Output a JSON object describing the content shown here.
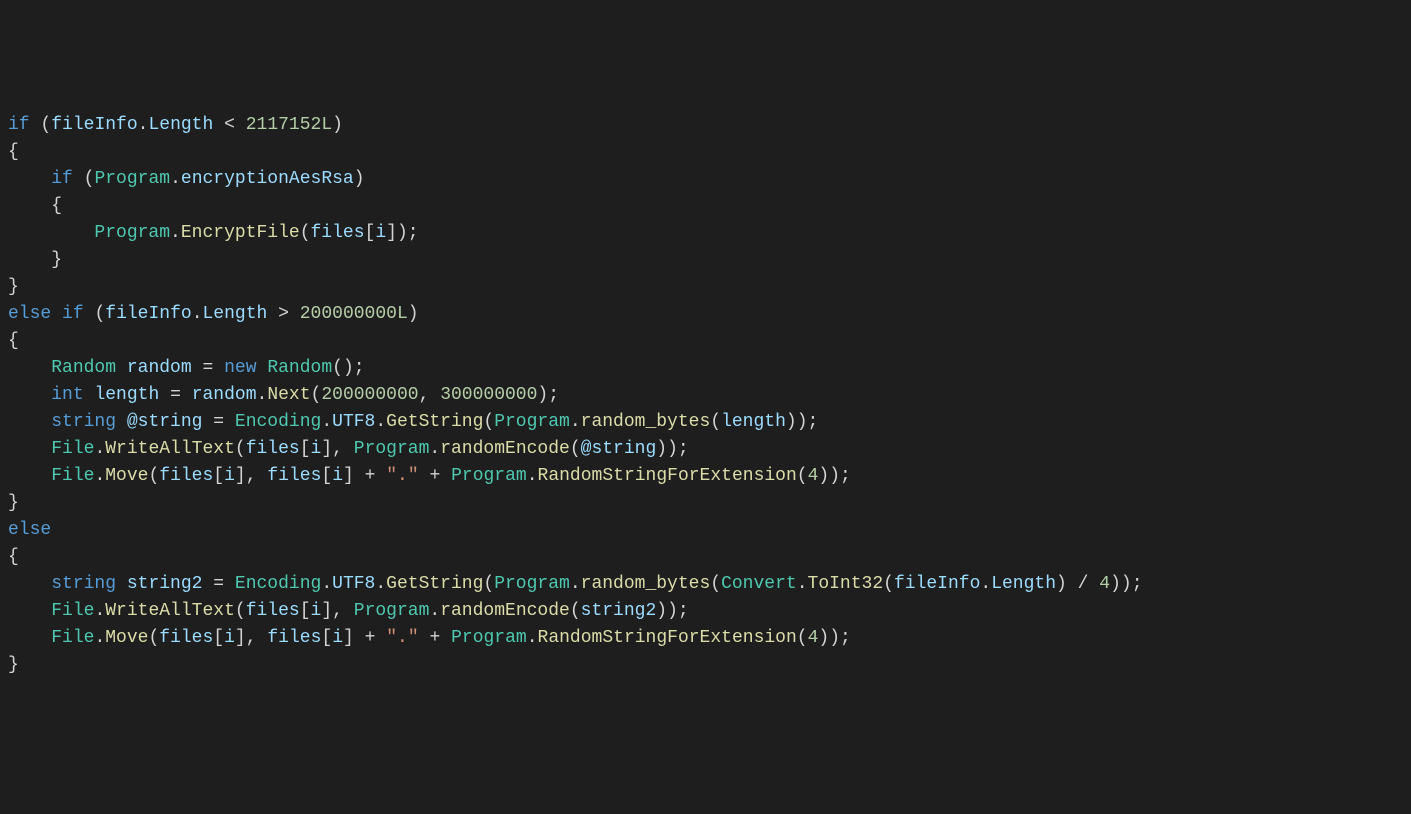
{
  "code": {
    "kw_if": "if",
    "kw_else": "else",
    "kw_new": "new",
    "type_int": "int",
    "type_string": "string",
    "cls_Program": "Program",
    "cls_Random": "Random",
    "cls_Encoding": "Encoding",
    "cls_File": "File",
    "cls_Convert": "Convert",
    "var_fileInfo": "fileInfo",
    "var_random": "random",
    "var_length": "length",
    "var_atstring": "@string",
    "var_string2": "string2",
    "var_files": "files",
    "var_i": "i",
    "prop_Length": "Length",
    "prop_encryptionAesRsa": "encryptionAesRsa",
    "prop_UTF8": "UTF8",
    "method_EncryptFile": "EncryptFile",
    "method_Next": "Next",
    "method_GetString": "GetString",
    "method_random_bytes": "random_bytes",
    "method_WriteAllText": "WriteAllText",
    "method_randomEncode": "randomEncode",
    "method_Move": "Move",
    "method_RandomStringForExtension": "RandomStringForExtension",
    "method_ToInt32": "ToInt32",
    "num_2117152L": "2117152L",
    "num_200000000L": "200000000L",
    "num_200000000": "200000000",
    "num_300000000": "300000000",
    "num_4": "4",
    "str_dot": "\".\"",
    "op_lt": "<",
    "op_gt": ">",
    "op_eq": "=",
    "op_plus": "+",
    "op_div": "/",
    "p_open": "(",
    "p_close": ")",
    "b_open": "{",
    "b_close": "}",
    "br_open": "[",
    "br_close": "]",
    "dot": ".",
    "comma": ",",
    "semi": ";"
  }
}
